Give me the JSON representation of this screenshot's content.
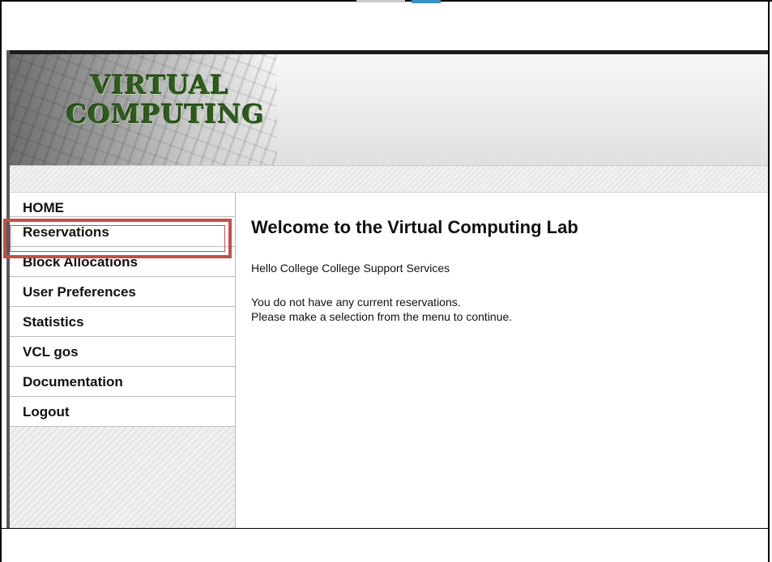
{
  "header": {
    "logo_line1": "VIRTUAL",
    "logo_line2": "COMPUTING"
  },
  "sidebar": {
    "items": [
      {
        "label": "HOME"
      },
      {
        "label": "Reservations"
      },
      {
        "label": "Block Allocations"
      },
      {
        "label": "User Preferences"
      },
      {
        "label": "Statistics"
      },
      {
        "label": "VCL gos"
      },
      {
        "label": "Documentation"
      },
      {
        "label": "Logout"
      }
    ],
    "highlighted_item": "Reservations",
    "highlight_color": "#c0504d"
  },
  "main": {
    "title": "Welcome to the Virtual Computing Lab",
    "greeting": "Hello College College Support Services",
    "message_line1": "You do not have any current reservations.",
    "message_line2": "Please make a selection from the menu to continue."
  },
  "colors": {
    "logo_text": "#2f5a1f",
    "header_border": "#1c1c1c"
  }
}
